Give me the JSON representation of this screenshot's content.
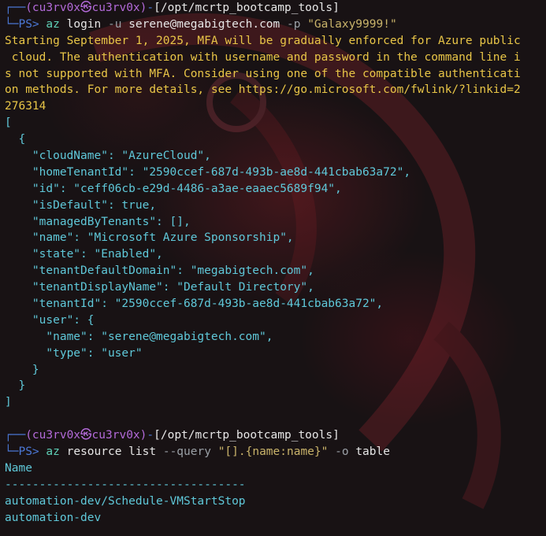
{
  "prompt1": {
    "user_host": "(cu3rv0x㉿cu3rv0x)",
    "path": "[/opt/mcrtp_bootcamp_tools]",
    "ps": "PS>",
    "cmd": "az",
    "sub": "login",
    "opt_u": "-u",
    "user_val": "serene@megabigtech.com",
    "opt_p": "-p",
    "pass_val": "\"Galaxy9999!\""
  },
  "warning_lines": [
    "Starting September 1, 2025, MFA will be gradually enforced for Azure public",
    " cloud. The authentication with username and password in the command line i",
    "s not supported with MFA. Consider using one of the compatible authenticati",
    "on methods. For more details, see https://go.microsoft.com/fwlink/?linkid=2",
    "276314"
  ],
  "json_output": [
    "[",
    "  {",
    "    \"cloudName\": \"AzureCloud\",",
    "    \"homeTenantId\": \"2590ccef-687d-493b-ae8d-441cbab63a72\",",
    "    \"id\": \"ceff06cb-e29d-4486-a3ae-eaaec5689f94\",",
    "    \"isDefault\": true,",
    "    \"managedByTenants\": [],",
    "    \"name\": \"Microsoft Azure Sponsorship\",",
    "    \"state\": \"Enabled\",",
    "    \"tenantDefaultDomain\": \"megabigtech.com\",",
    "    \"tenantDisplayName\": \"Default Directory\",",
    "    \"tenantId\": \"2590ccef-687d-493b-ae8d-441cbab63a72\",",
    "    \"user\": {",
    "      \"name\": \"serene@megabigtech.com\",",
    "      \"type\": \"user\"",
    "    }",
    "  }",
    "]"
  ],
  "prompt2": {
    "user_host": "(cu3rv0x㉿cu3rv0x)",
    "path": "[/opt/mcrtp_bootcamp_tools]",
    "ps": "PS>",
    "cmd": "az",
    "sub": "resource list",
    "opt_query": "--query",
    "query_val": "\"[].{name:name}\"",
    "opt_o": "-o",
    "o_val": "table"
  },
  "table": {
    "header": "Name",
    "separator": "-----------------------------------",
    "rows": [
      "automation-dev/Schedule-VMStartStop",
      "automation-dev"
    ]
  },
  "colors": {
    "background": "#181214",
    "frame": "#4b78d6",
    "userhost": "#b36ad9",
    "command": "#5fd1b8",
    "warning": "#e8c547",
    "output": "#5fc8d9"
  }
}
